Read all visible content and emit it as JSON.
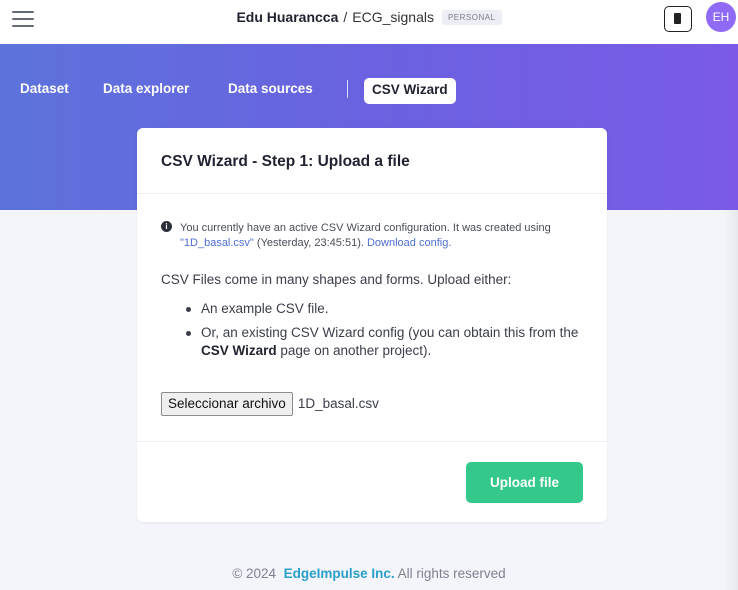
{
  "header": {
    "owner": "Edu Huarancca",
    "separator": "/",
    "project": "ECG_signals",
    "badge": "PERSONAL",
    "menu_icon": "hamburger-menu-icon",
    "device_icon": "chip-icon",
    "avatar_initials": "EH",
    "avatar_color": "#8f6af5"
  },
  "tabs": [
    {
      "label": "Dataset"
    },
    {
      "label": "Data explorer"
    },
    {
      "label": "Data sources"
    },
    {
      "label": "CSV Wizard",
      "active": true
    }
  ],
  "card": {
    "title": "CSV Wizard - Step 1: Upload a file",
    "notice": {
      "icon": "info-icon",
      "text_before": "You currently have an active CSV Wizard configuration. It was created using ",
      "filename": "\"1D_basal.csv\"",
      "text_after": " (Yesterday, 23:45:51). ",
      "link": "Download config."
    },
    "description": "CSV Files come in many shapes and forms. Upload either:",
    "option1": "An example CSV file.",
    "option2_before": "Or, an existing CSV Wizard config (you can obtain this from the ",
    "option2_bold": "CSV Wizard",
    "option2_after": " page on another project).",
    "file_button": "Seleccionar archivo",
    "file_name": "1D_basal.csv",
    "upload_button": "Upload file"
  },
  "footer": {
    "copyright": "© 2024",
    "brand": "EdgeImpulse Inc.",
    "rights": "All rights reserved"
  },
  "colors": {
    "gradient_start": "#5d73dc",
    "gradient_end": "#7a5ae6",
    "upload_button": "#34c98a",
    "link": "#4f6fd6",
    "footer_brand": "#2a9fc7"
  }
}
